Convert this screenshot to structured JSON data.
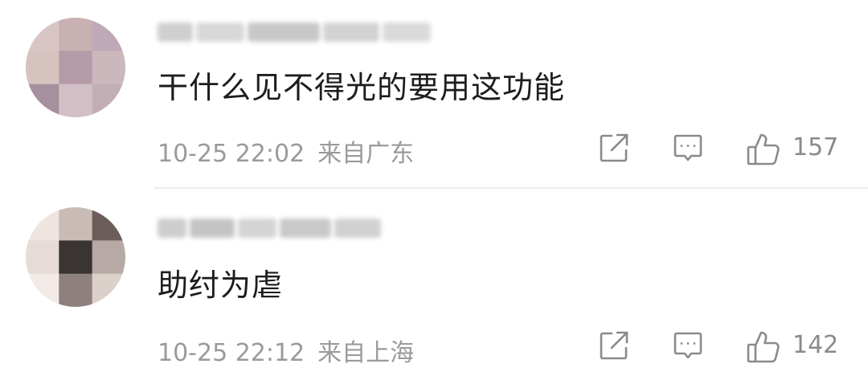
{
  "comments": [
    {
      "text": "干什么见不得光的要用这功能",
      "date": "10-25 22:02",
      "location": "来自广东",
      "likes": "157",
      "avatar_colors": [
        "#d9c6c4",
        "#c9b0b2",
        "#bfa8b8",
        "#d6c3bf",
        "#b59aa8",
        "#cbb8bc",
        "#a7909e",
        "#d2c0c6",
        "#c4aeb6"
      ]
    },
    {
      "text": "助纣为虐",
      "date": "10-25 22:12",
      "location": "来自上海",
      "likes": "142",
      "avatar_colors": [
        "#efe5e0",
        "#c9bcb6",
        "#6b5e5a",
        "#e6dbd6",
        "#3a3432",
        "#b7aaa6",
        "#f1eae6",
        "#8e807c",
        "#dcd0cb"
      ]
    }
  ],
  "icons": {
    "share": "share-icon",
    "reply": "reply-icon",
    "like": "like-icon"
  },
  "colors": {
    "text": "#1d1d1d",
    "meta": "#9a9a9a",
    "icon": "#8a8a8a",
    "divider": "#ececec"
  }
}
